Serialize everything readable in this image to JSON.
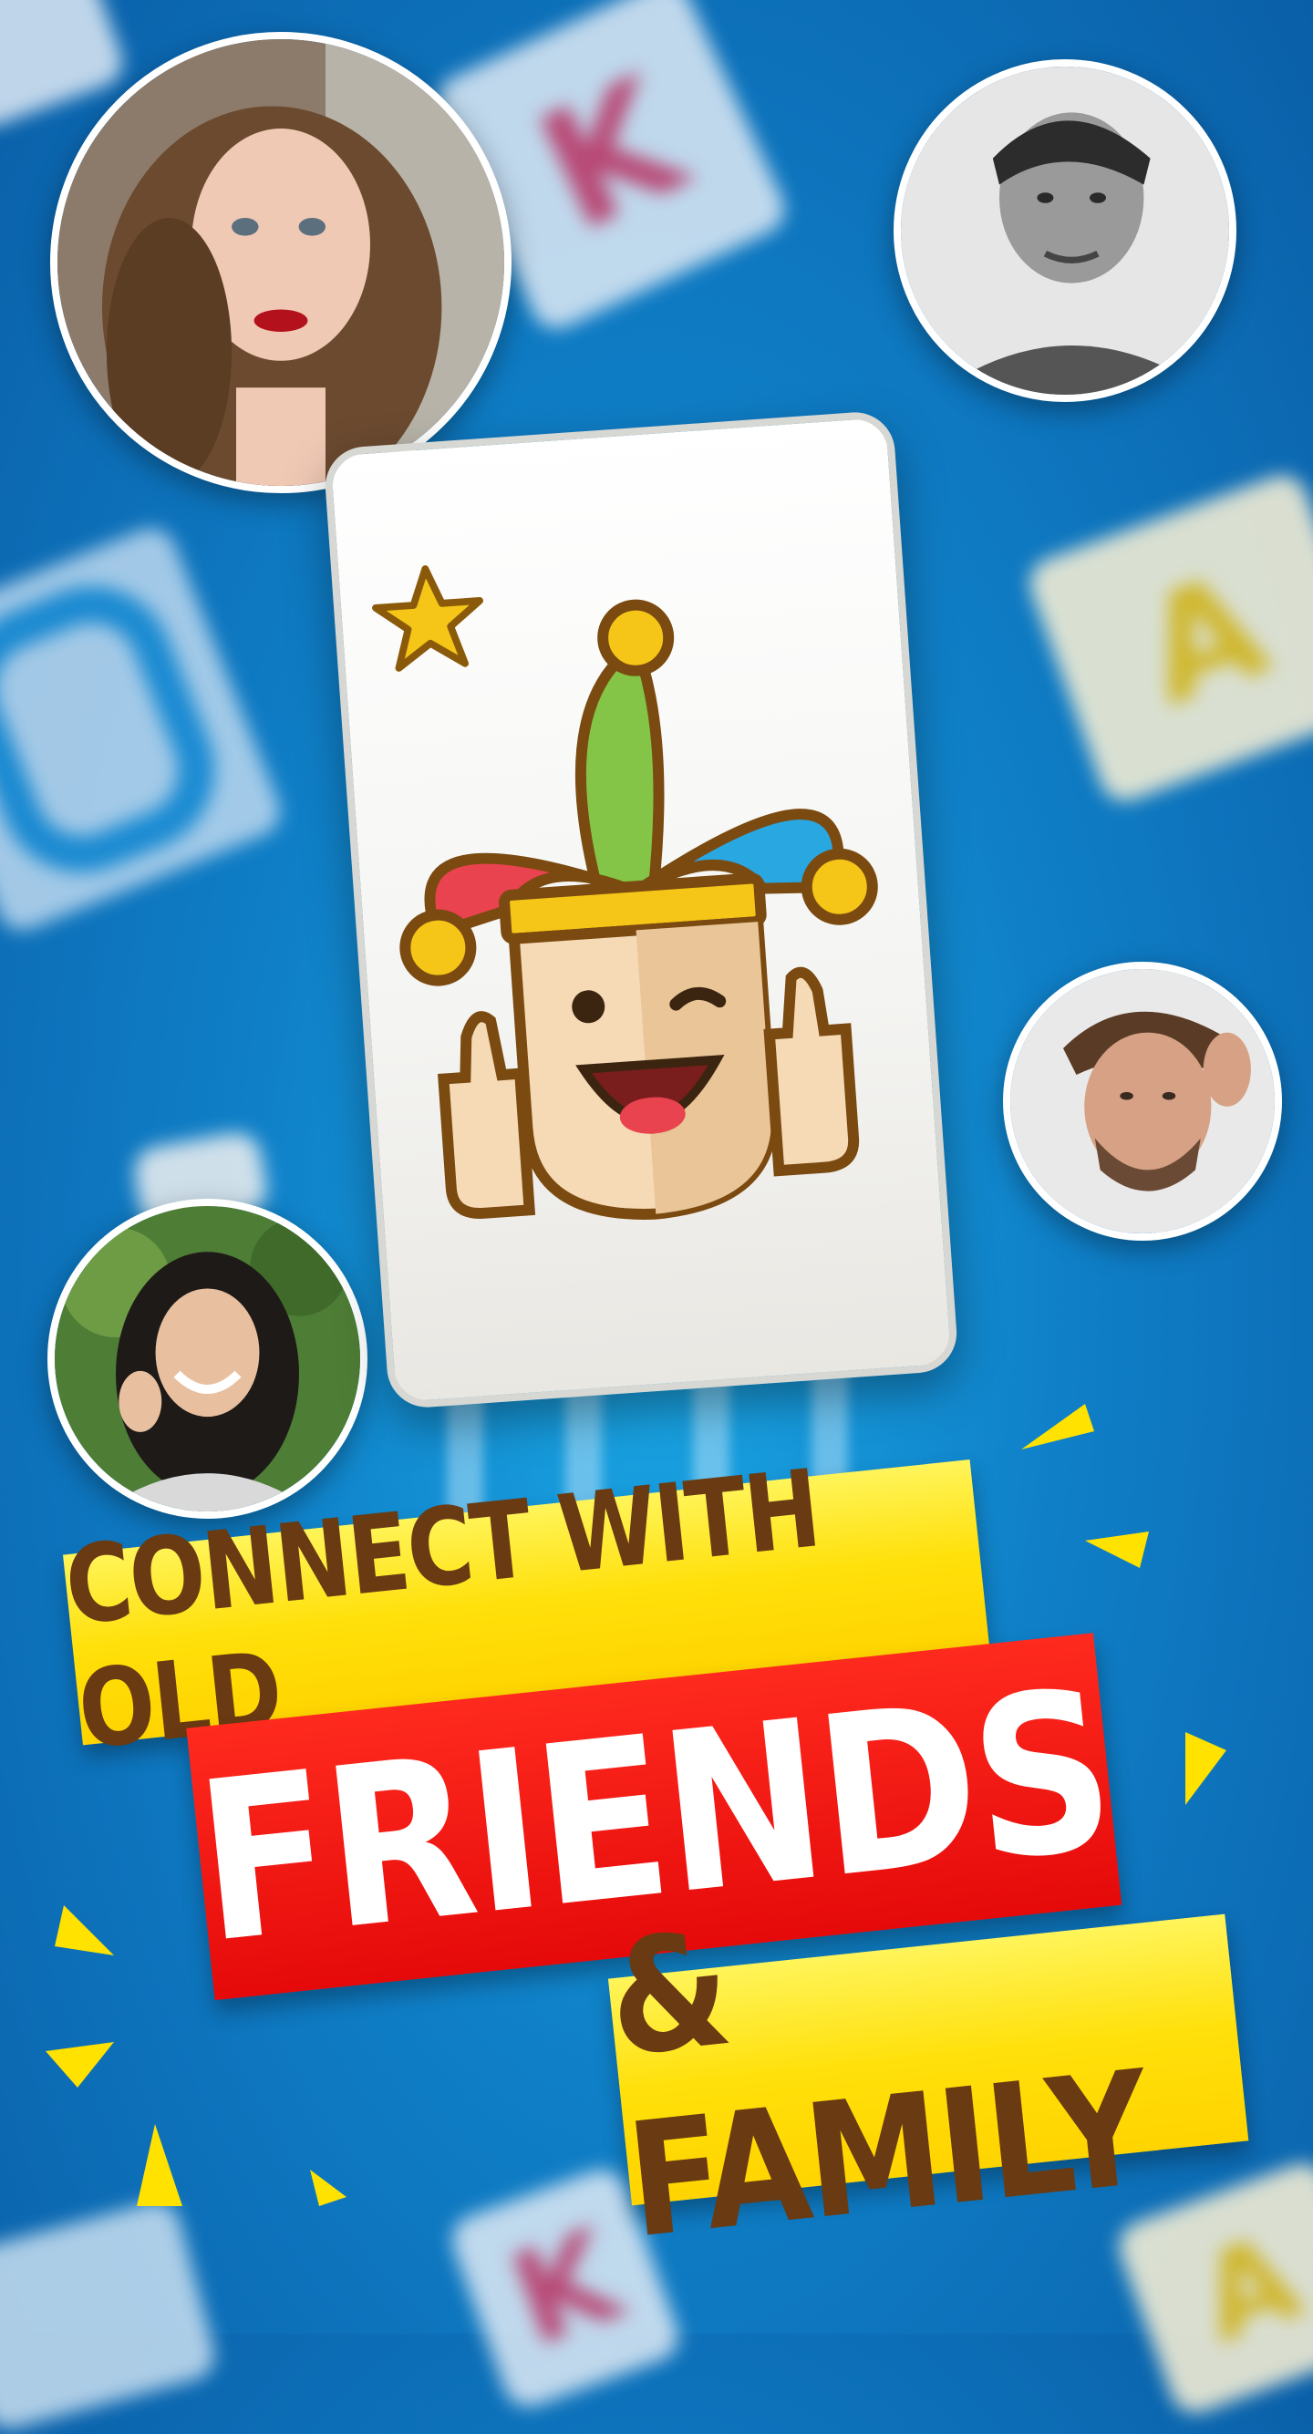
{
  "headline": {
    "line1": "CONNECT WITH OLD",
    "line2": "FRIENDS",
    "line3": "& FAMILY"
  },
  "icons": {
    "star": "star-icon",
    "jester": "jester-icon"
  },
  "colors": {
    "background": "#0f7fc7",
    "banner_yellow": "#ffe00a",
    "banner_red": "#e50a0a",
    "banner_text_brown": "#6a3a12",
    "banner_text_white": "#ffffff"
  }
}
